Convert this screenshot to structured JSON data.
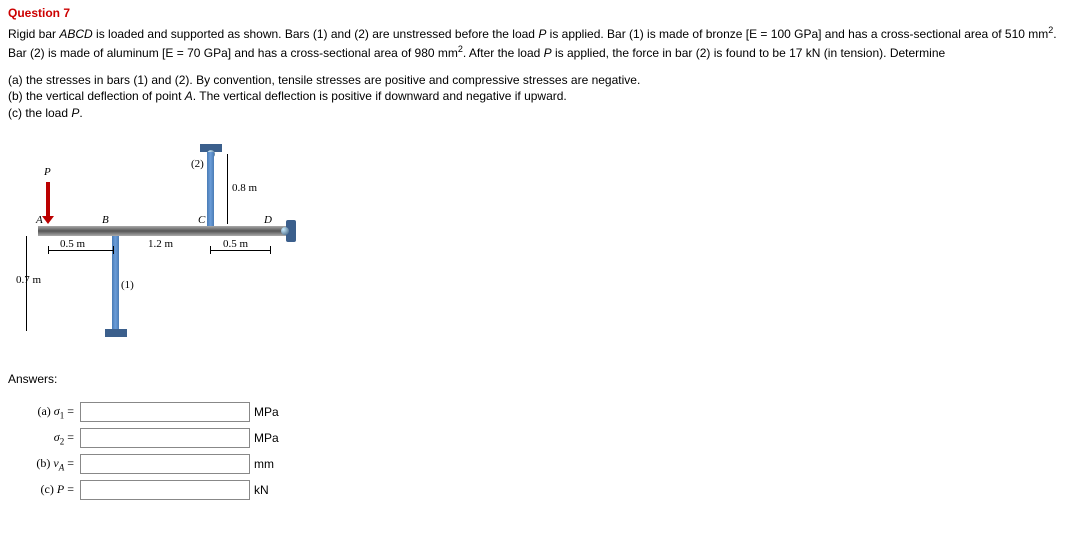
{
  "question": {
    "header": "Question 7",
    "paragraph1_html": "Rigid bar <span class='italic'>ABCD</span> is loaded and supported as shown. Bars (1) and (2) are unstressed before the load <span class='italic'>P</span> is applied. Bar (1) is made of bronze [E = 100 GPa] and has a cross-sectional area of 510 mm<span class='superscript'>2</span>. Bar (2) is made of aluminum [E = 70 GPa] and has a cross-sectional area of 980 mm<span class='superscript'>2</span>. After the load <span class='italic'>P</span> is applied, the force in bar (2) is found to be 17 kN (in tension). Determine",
    "parts_html": "(a) the stresses in bars (1) and (2). By convention, tensile stresses are positive and compressive stresses are negative.<br>(b) the vertical deflection of point <span class='italic'>A</span>. The vertical deflection is positive if downward and negative if upward.<br>(c) the load <span class='italic'>P</span>."
  },
  "diagram": {
    "labels": {
      "P": "P",
      "A": "A",
      "B": "B",
      "C": "C",
      "D": "D",
      "bar1": "(1)",
      "bar2": "(2)",
      "dim_0_5m_a": "0.5 m",
      "dim_1_2m": "1.2 m",
      "dim_0_5m_b": "0.5 m",
      "dim_0_7m": "0.7 m",
      "dim_0_8m": "0.8 m"
    }
  },
  "answers": {
    "header": "Answers:",
    "rows": [
      {
        "label_html": "(a) <span class='italic'>σ</span><span class='subscript'>1</span> =",
        "unit": "MPa"
      },
      {
        "label_html": "<span class='italic'>σ</span><span class='subscript'>2</span> =",
        "unit": "MPa"
      },
      {
        "label_html": "(b) <span class='italic'>v<span class='subscript'>A</span></span> =",
        "unit": "mm"
      },
      {
        "label_html": "(c) <span class='italic'>P</span> =",
        "unit": "kN"
      }
    ]
  }
}
